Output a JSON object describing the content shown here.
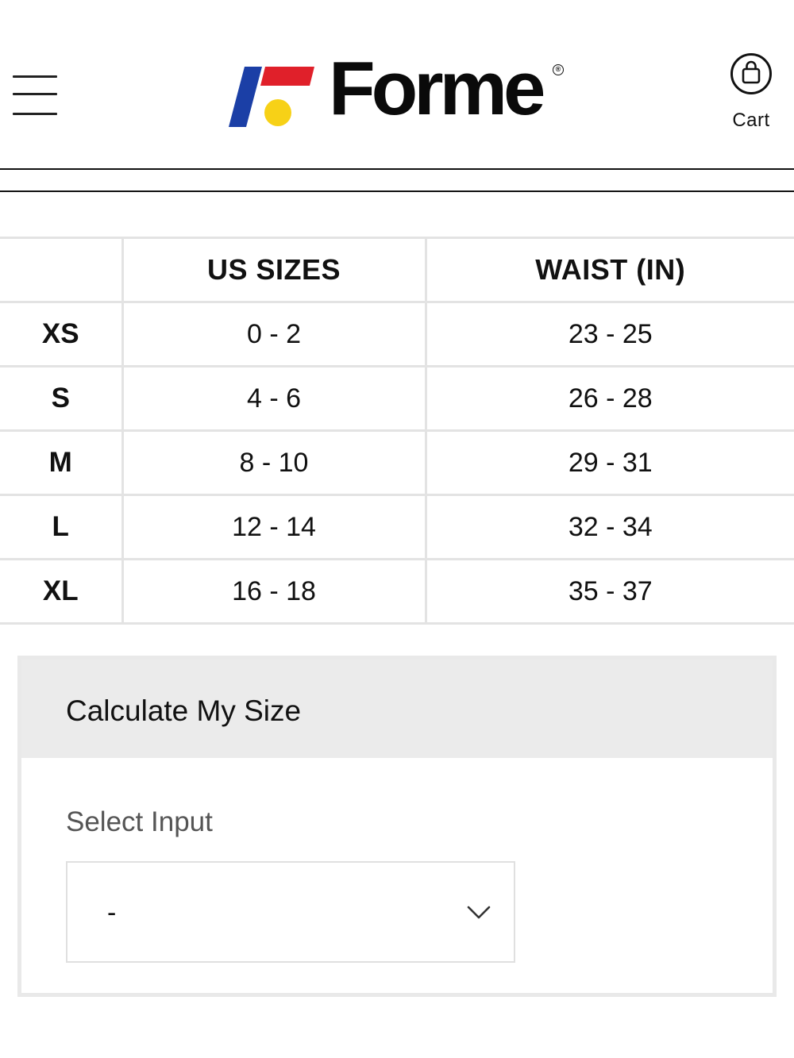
{
  "header": {
    "brand_name": "Forme",
    "brand_mark": "®",
    "menu_icon": "hamburger-menu-icon",
    "cart_icon": "shopping-bag-icon",
    "cart_label": "Cart",
    "brand_colors": {
      "blue": "#1b3fa6",
      "red": "#e0202a",
      "yellow": "#f7d117"
    }
  },
  "size_chart": {
    "columns": [
      "",
      "US SIZES",
      "WAIST (IN)"
    ],
    "rows": [
      {
        "size": "XS",
        "us": "0 - 2",
        "waist": "23 - 25"
      },
      {
        "size": "S",
        "us": "4 - 6",
        "waist": "26 - 28"
      },
      {
        "size": "M",
        "us": "8 - 10",
        "waist": "29 - 31"
      },
      {
        "size": "L",
        "us": "12 - 14",
        "waist": "32 - 34"
      },
      {
        "size": "XL",
        "us": "16 - 18",
        "waist": "35 - 37"
      }
    ]
  },
  "calculator": {
    "title": "Calculate My Size",
    "input_label": "Select Input",
    "select_value": "-",
    "select_icon": "chevron-down-icon"
  }
}
